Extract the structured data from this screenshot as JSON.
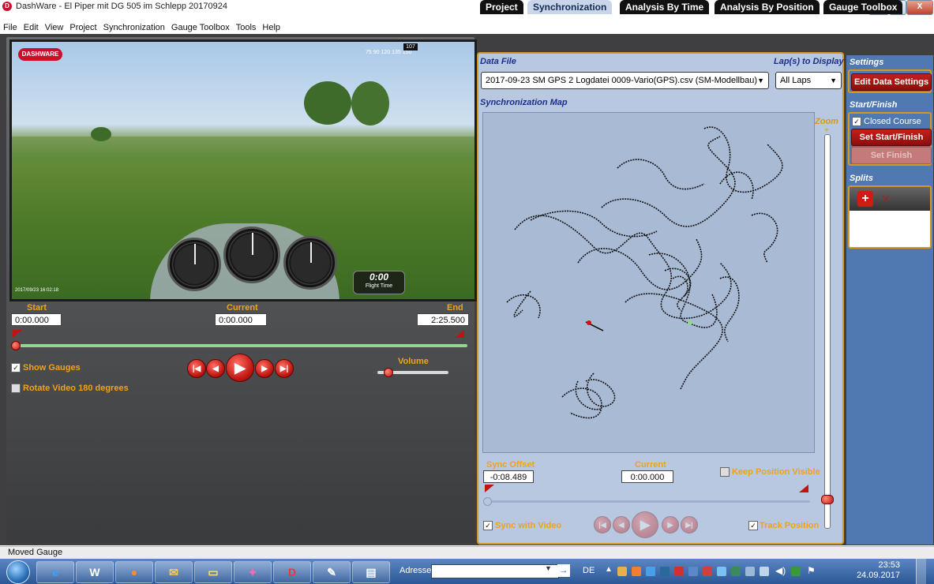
{
  "window": {
    "title": "DashWare - El Piper mit DG 505 im Schlepp 20170924",
    "app_icon_text": "D",
    "minimize": "–",
    "maximize": "☐",
    "close": "X"
  },
  "menu": [
    "File",
    "Edit",
    "View",
    "Project",
    "Synchronization",
    "Gauge Toolbox",
    "Tools",
    "Help"
  ],
  "video": {
    "logo": "DASHWARE",
    "heading_readout": "107",
    "heading_ticks": "75   90   120  135  150",
    "flight_time": "0:00",
    "flight_time_label": "Flight Time",
    "timestamp": "2017/09/23  16:02:18"
  },
  "timeline": {
    "start_label": "Start",
    "current_label": "Current",
    "end_label": "End",
    "start_value": "0:00.000",
    "current_value": "0:00.000",
    "end_value": "2:25.500",
    "volume_label": "Volume",
    "show_gauges_label": "Show Gauges",
    "show_gauges_checked": true,
    "rotate_label": "Rotate Video 180 degrees",
    "rotate_checked": false
  },
  "tabs": [
    "Project",
    "Synchronization",
    "Analysis By Time",
    "Analysis By Position",
    "Gauge Toolbox"
  ],
  "active_tab": "Synchronization",
  "sync": {
    "data_file_label": "Data File",
    "data_file_value": "2017-09-23 SM GPS 2 Logdatei 0009-Vario(GPS).csv (SM-Modellbau)",
    "laps_label": "Lap(s) to Display",
    "laps_value": "All Laps",
    "map_label": "Synchronization Map",
    "zoom_label": "Zoom",
    "sync_offset_label": "Sync Offset",
    "sync_offset_value": "-0:08.489",
    "current_label": "Current",
    "current_value": "0:00.000",
    "keep_position_label": "Keep Position Visible",
    "sync_with_video_label": "Sync with Video",
    "track_position_label": "Track Position"
  },
  "settings": {
    "settings_label": "Settings",
    "edit_data_settings": "Edit Data Settings",
    "start_finish_label": "Start/Finish",
    "closed_course_label": "Closed Course",
    "set_start_finish": "Set Start/Finish",
    "set_finish": "Set Finish",
    "splits_label": "Splits"
  },
  "status": "Moved Gauge",
  "taskbar": {
    "address_label": "Adresse",
    "language": "DE",
    "time": "23:53",
    "date": "24.09.2017"
  },
  "colors": {
    "accent_orange": "#f0a21a",
    "tab_active": "#c9d6ea",
    "panel_blue": "#b8c8e0",
    "button_red": "#c0221d"
  }
}
